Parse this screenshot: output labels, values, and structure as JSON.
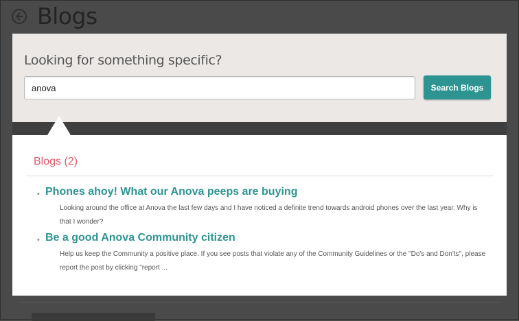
{
  "page": {
    "title": "Blogs"
  },
  "search": {
    "prompt": "Looking for something specific?",
    "query": "anova",
    "button_label": "Search Blogs"
  },
  "results": {
    "heading": "Blogs (2)",
    "items": [
      {
        "title": "Phones ahoy! What our Anova peeps are buying",
        "excerpt": "Looking around the office at Anova the last few days and I have noticed a definite trend towards android phones over the last year. Why is that I wonder?"
      },
      {
        "title": "Be a good Anova Community citizen",
        "excerpt": "Help us keep the Community a positive place. If you see posts that violate any of the Community Guidelines or the \"Do's and Don'ts\", please report the post by clicking \"report ..."
      }
    ]
  },
  "colors": {
    "accent": "#2e9492",
    "heading_red": "#e05a6a",
    "overlay": "#4a4a4a"
  }
}
